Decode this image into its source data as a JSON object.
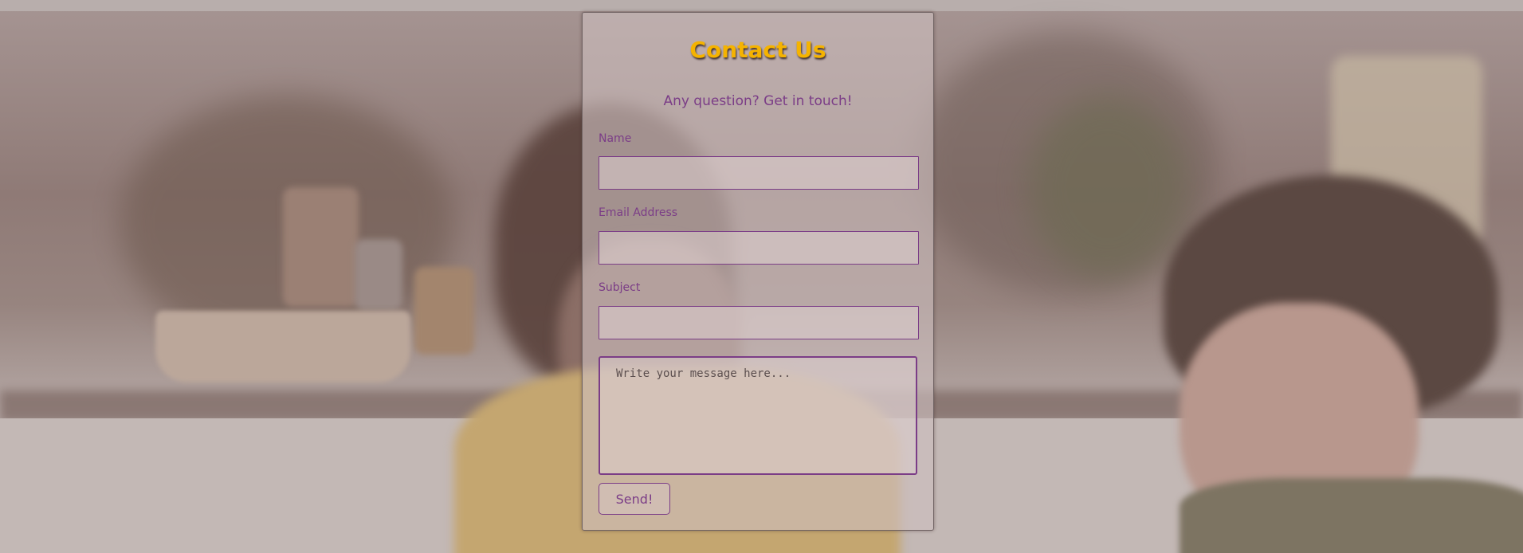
{
  "contact": {
    "title": "Contact Us",
    "subtitle": "Any question? Get in touch!",
    "fields": {
      "name": {
        "label": "Name",
        "value": ""
      },
      "email": {
        "label": "Email Address",
        "value": ""
      },
      "subject": {
        "label": "Subject",
        "value": ""
      },
      "message": {
        "placeholder": "Write your message here...",
        "value": ""
      }
    },
    "send_label": "Send!"
  },
  "colors": {
    "accent": "#7b3d87",
    "title": "#f5b300"
  }
}
